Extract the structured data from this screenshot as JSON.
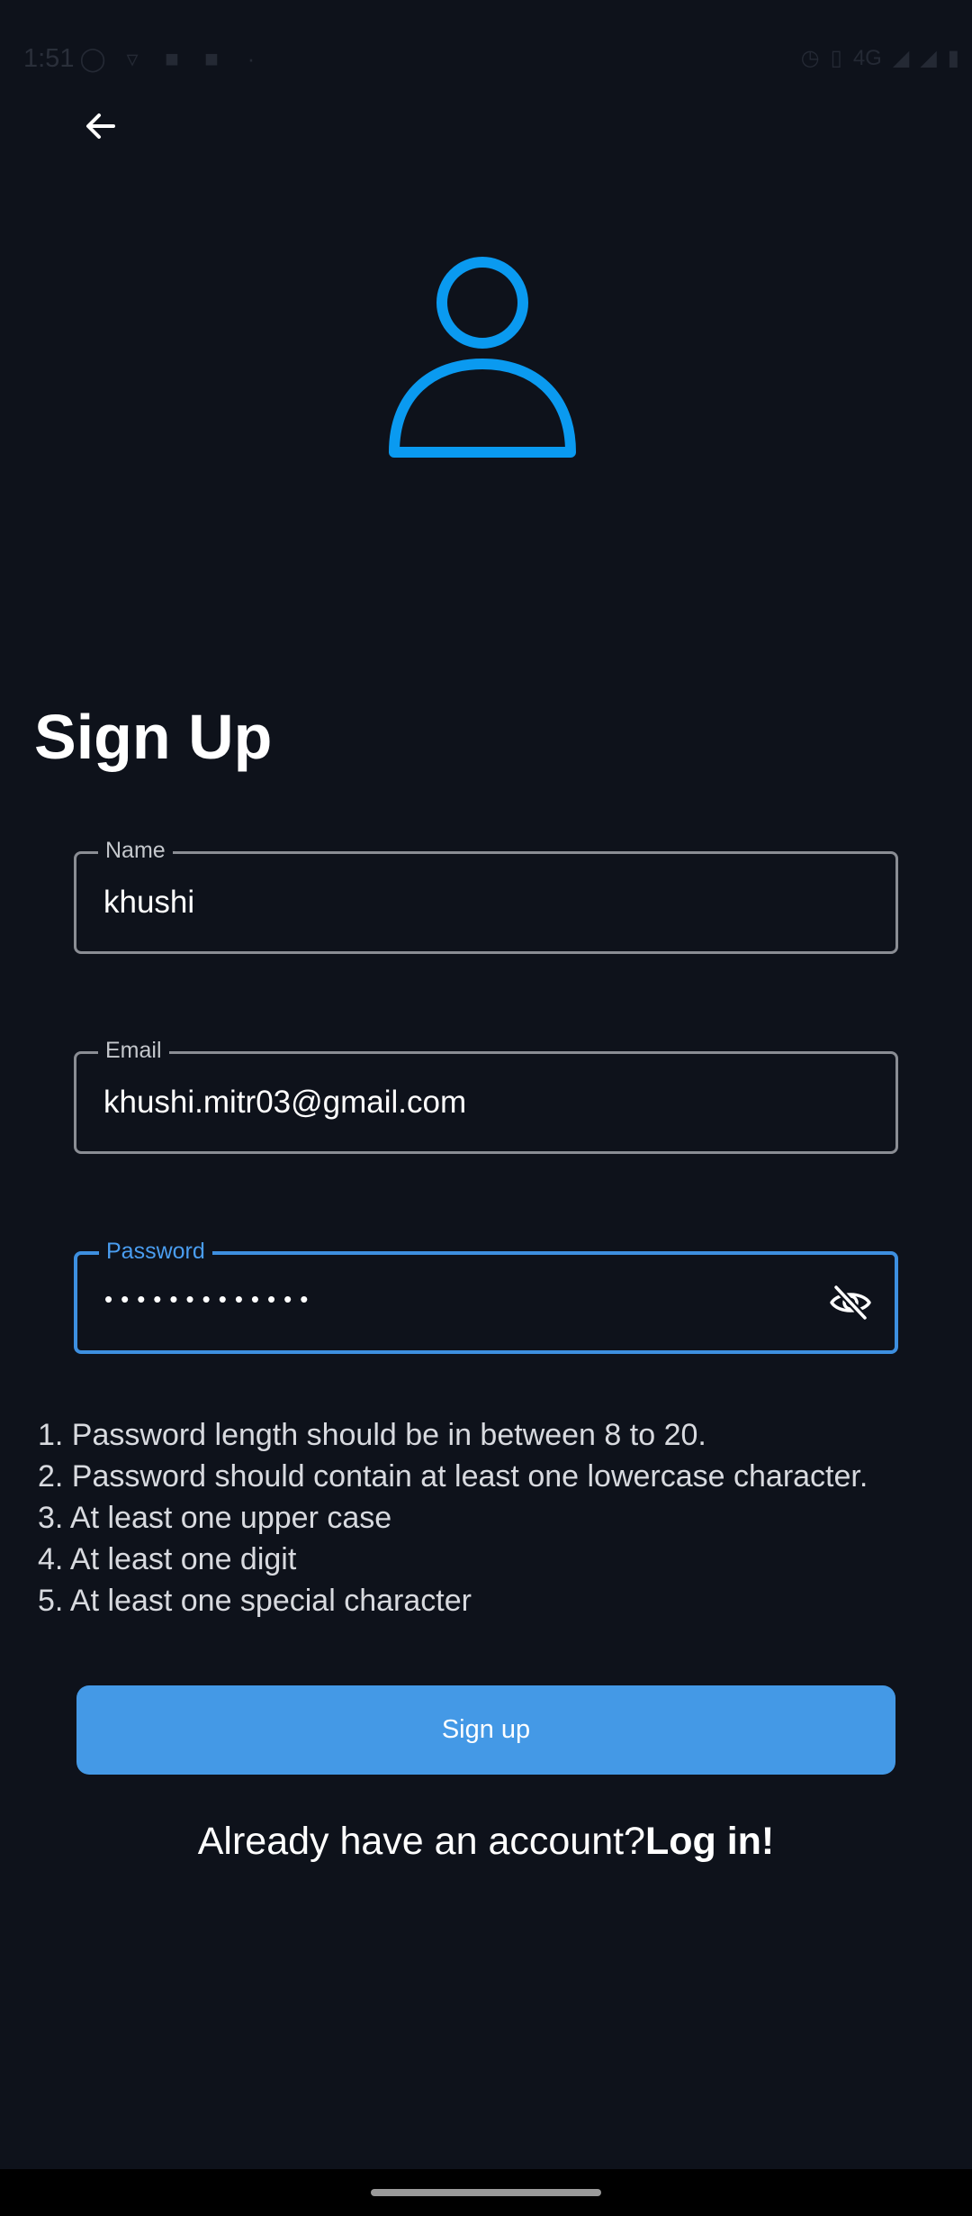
{
  "status_bar": {
    "time": "1:51",
    "network": "4G"
  },
  "header": {
    "back_icon": "arrow-left-icon"
  },
  "avatar": {
    "icon": "person-outline-icon",
    "color": "#0a9af0"
  },
  "title": "Sign Up",
  "form": {
    "name": {
      "label": "Name",
      "value": "khushi"
    },
    "email": {
      "label": "Email",
      "value": "khushi.mitr03@gmail.com"
    },
    "password": {
      "label": "Password",
      "value": "•••••••••••••",
      "toggle_icon": "eye-off-icon"
    }
  },
  "password_rules": [
    "1. Password length should be in between 8 to 20.",
    "2. Password should contain at least one lowercase character.",
    "3. At least one upper case",
    "4. At least one digit",
    "5. At least one special character"
  ],
  "signup_button": {
    "label": "Sign up",
    "color": "#4499e6"
  },
  "login_prompt": {
    "text": "Already have an account?",
    "link": "Log in!"
  },
  "colors": {
    "background": "#0e121b",
    "accent": "#3d8fe0"
  }
}
